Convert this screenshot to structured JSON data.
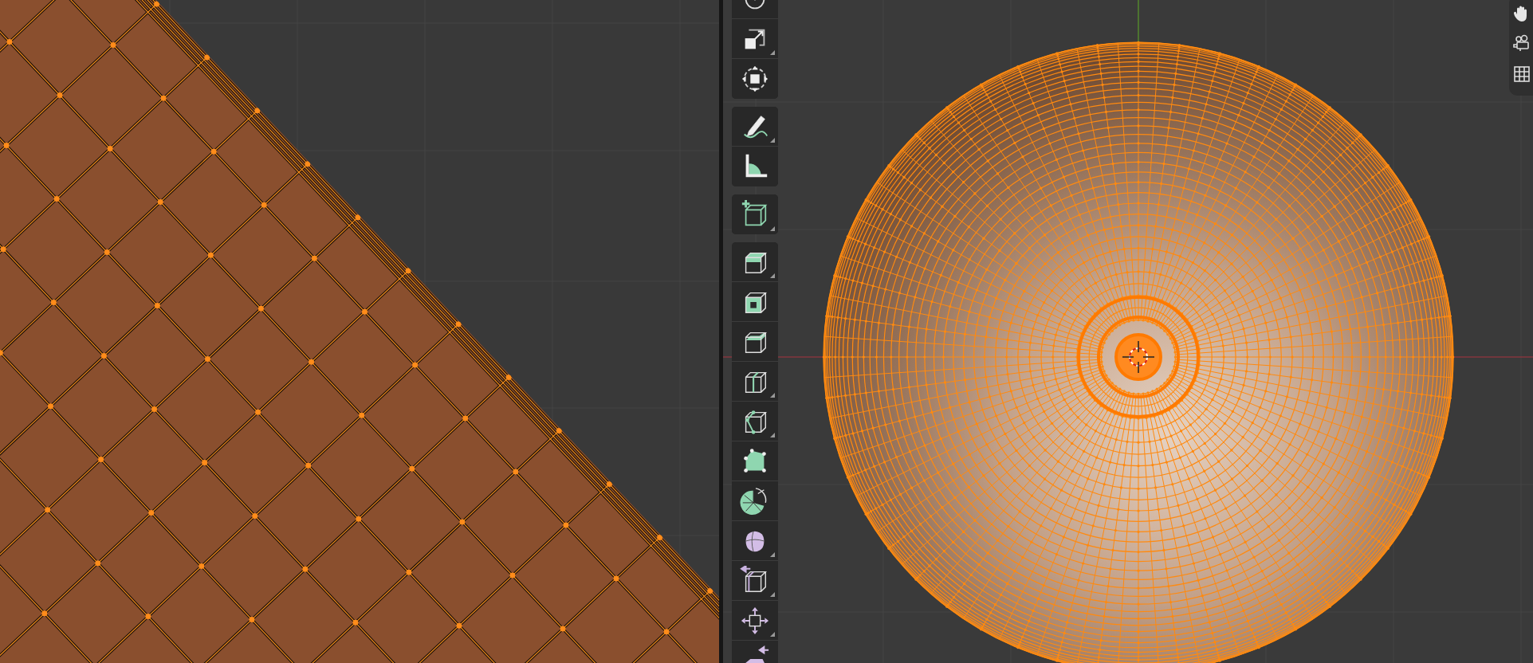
{
  "toolbar": {
    "groups": [
      {
        "tools": [
          {
            "kind": "rotate",
            "submenu": false
          },
          {
            "kind": "scale",
            "submenu": true
          },
          {
            "kind": "transform",
            "submenu": false
          }
        ]
      },
      {
        "tools": [
          {
            "kind": "annotate",
            "submenu": true
          },
          {
            "kind": "measure",
            "submenu": false
          }
        ]
      },
      {
        "tools": [
          {
            "kind": "add_cube",
            "submenu": true
          }
        ]
      },
      {
        "tools": [
          {
            "kind": "extrude",
            "submenu": true
          },
          {
            "kind": "inset",
            "submenu": false
          },
          {
            "kind": "bevel",
            "submenu": false
          },
          {
            "kind": "loop_cut",
            "submenu": true
          },
          {
            "kind": "knife",
            "submenu": true
          },
          {
            "kind": "poly_build",
            "submenu": false
          },
          {
            "kind": "spin",
            "submenu": false
          },
          {
            "kind": "smooth",
            "submenu": true
          },
          {
            "kind": "edge_slide",
            "submenu": true
          },
          {
            "kind": "shrink_fatten",
            "submenu": true
          },
          {
            "kind": "push_pull",
            "submenu": false
          }
        ]
      }
    ]
  },
  "navigation": {
    "tools": [
      {
        "kind": "hand"
      },
      {
        "kind": "camera"
      },
      {
        "kind": "grid"
      }
    ]
  }
}
